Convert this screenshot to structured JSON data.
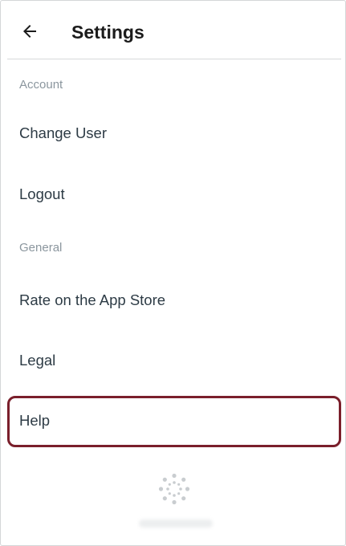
{
  "header": {
    "title": "Settings"
  },
  "sections": {
    "account": {
      "label": "Account",
      "items": [
        "Change User",
        "Logout"
      ]
    },
    "general": {
      "label": "General",
      "items": [
        "Rate on the App Store",
        "Legal",
        "Help"
      ]
    }
  },
  "highlighted_item": "Help",
  "colors": {
    "highlight_border": "#7a1f2b",
    "section_header": "#8b969e",
    "item_text": "#2d3b45"
  },
  "icons": {
    "back": "arrow-left-icon",
    "logo": "canvas-logo-icon"
  }
}
